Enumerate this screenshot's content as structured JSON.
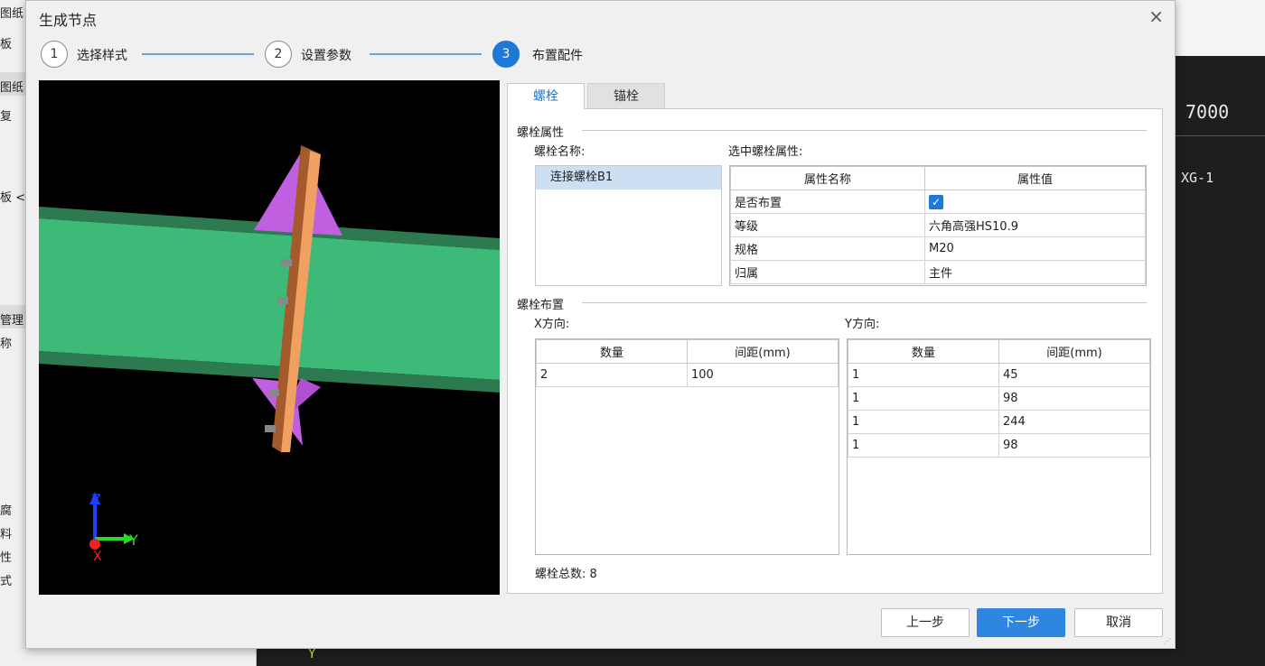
{
  "background": {
    "left_panel_items": [
      "图纸",
      "板",
      "图纸",
      "复",
      "板 <",
      "管理",
      "称",
      "腐",
      "料",
      "性",
      "式"
    ],
    "cad_texts": [
      "7000",
      "XG-1",
      "Y"
    ]
  },
  "dialog": {
    "title": "生成节点",
    "close_icon": "×",
    "steps": [
      {
        "num": "1",
        "label": "选择样式"
      },
      {
        "num": "2",
        "label": "设置参数"
      },
      {
        "num": "3",
        "label": "布置配件"
      }
    ],
    "active_step": 3,
    "axis_labels": {
      "z": "Z",
      "y": "Y",
      "x": "X"
    },
    "tabs": {
      "bolt": "螺栓",
      "anchor": "锚栓"
    },
    "bolt_props": {
      "group_title": "螺栓属性",
      "name_label": "螺栓名称:",
      "selected_label": "选中螺栓属性:",
      "bolt_names": [
        "连接螺栓B1"
      ],
      "prop_headers": [
        "属性名称",
        "属性值"
      ],
      "props": [
        {
          "name": "是否布置",
          "value": "✓",
          "is_checkbox": true
        },
        {
          "name": "等级",
          "value": "六角高强HS10.9"
        },
        {
          "name": "规格",
          "value": "M20"
        },
        {
          "name": "归属",
          "value": "主件"
        }
      ]
    },
    "bolt_layout": {
      "group_title": "螺栓布置",
      "x_label": "X方向:",
      "y_label": "Y方向:",
      "headers": [
        "数量",
        "间距(mm)"
      ],
      "x_rows": [
        {
          "qty": "2",
          "spacing": "100"
        }
      ],
      "y_rows": [
        {
          "qty": "1",
          "spacing": "45"
        },
        {
          "qty": "1",
          "spacing": "98"
        },
        {
          "qty": "1",
          "spacing": "244"
        },
        {
          "qty": "1",
          "spacing": "98"
        }
      ],
      "total": "螺栓总数: 8"
    },
    "buttons": {
      "prev": "上一步",
      "next": "下一步",
      "cancel": "取消"
    }
  },
  "colors": {
    "accent": "#1e78d7",
    "beam_green": "#3dba78",
    "plate_orange": "#f0a060",
    "stiffener_purple": "#c060e0"
  }
}
